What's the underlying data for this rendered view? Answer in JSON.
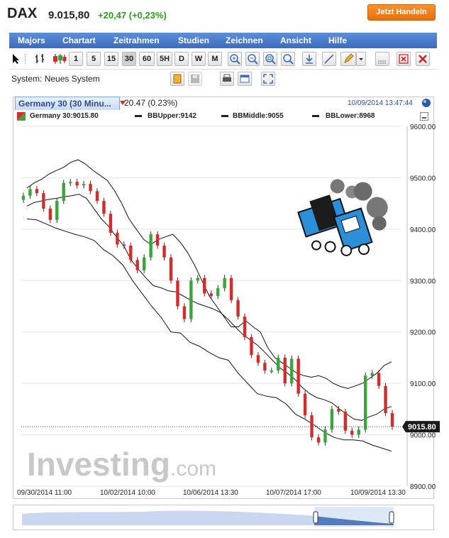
{
  "header": {
    "symbol": "DAX",
    "price": "9.015,80",
    "change": "+20,47 (+0,23%)",
    "trade_button": "Jetzt Handeln"
  },
  "menu": [
    "Majors",
    "Chartart",
    "Zeitrahmen",
    "Studien",
    "Zeichnen",
    "Ansicht",
    "Hilfe"
  ],
  "toolbar": {
    "timeframes": [
      "1",
      "5",
      "15",
      "30",
      "60",
      "5H",
      "D",
      "W",
      "M"
    ],
    "selected_timeframe": "30"
  },
  "system_bar": {
    "label": "System:",
    "value": "Neues System"
  },
  "chart_tab": {
    "title": "Germany 30 (30 Minu...",
    "change": "20.47 (0.23%)",
    "datetime": "10/09/2014 13:47:44"
  },
  "legend": {
    "instrument": "Germany 30:9015.80",
    "bb_upper": "BBUpper:9142",
    "bb_middle": "BBMiddle:9055",
    "bb_lower": "BBLower:8968"
  },
  "watermark": {
    "brand": "Investing",
    "suffix": ".com"
  },
  "colors": {
    "up": "#3aa53a",
    "down": "#d62b2b",
    "accent": "#3a6bbf",
    "trade": "#f0841f"
  },
  "chart_data": {
    "type": "line",
    "title": "Germany 30 (30 Minu...",
    "xlabel": "",
    "ylabel": "",
    "ylim": [
      8900,
      9600
    ],
    "y_ticks": [
      "9600.00",
      "9500.00",
      "9400.00",
      "9300.00",
      "9200.00",
      "9100.00",
      "9000.00",
      "8900.00"
    ],
    "x_ticks": [
      "09/30/2014 11:00",
      "10/02/2014 10:00",
      "10/06/2014 13:30",
      "10/07/2014 17:00",
      "10/09/2014 13:30"
    ],
    "last_price_label": "9015.80",
    "last_price": 9015.8,
    "series": [
      {
        "name": "Germany 30",
        "values": [
          9465,
          9478,
          9470,
          9440,
          9418,
          9455,
          9490,
          9492,
          9485,
          9488,
          9474,
          9455,
          9430,
          9393,
          9370,
          9368,
          9340,
          9320,
          9345,
          9390,
          9368,
          9345,
          9300,
          9250,
          9225,
          9300,
          9305,
          9275,
          9270,
          9285,
          9305,
          9262,
          9230,
          9190,
          9155,
          9140,
          9125,
          9125,
          9150,
          9100,
          9148,
          9080,
          9038,
          8995,
          8985,
          9010,
          9050,
          9045,
          9008,
          9000,
          9010,
          9115,
          9120,
          9095,
          9042,
          9015.8
        ]
      },
      {
        "name": "BBUpper",
        "values": [
          9480,
          9490,
          9497,
          9507,
          9514,
          9520,
          9530,
          9535,
          9527,
          9515,
          9505,
          9495,
          9475,
          9450,
          9420,
          9400,
          9380,
          9370,
          9380,
          9385,
          9390,
          9375,
          9355,
          9330,
          9300,
          9270,
          9250,
          9230,
          9210,
          9210,
          9222,
          9210,
          9200,
          9170,
          9150,
          9140,
          9130,
          9120,
          9115,
          9112,
          9115,
          9110,
          9100,
          9094,
          9090,
          9095,
          9100,
          9110,
          9120,
          9135,
          9142
        ]
      },
      {
        "name": "BBMiddle",
        "values": [
          9445,
          9452,
          9455,
          9458,
          9460,
          9463,
          9465,
          9468,
          9460,
          9440,
          9420,
          9405,
          9385,
          9368,
          9340,
          9322,
          9305,
          9290,
          9286,
          9280,
          9278,
          9270,
          9262,
          9255,
          9250,
          9245,
          9238,
          9225,
          9210,
          9195,
          9185,
          9174,
          9160,
          9145,
          9130,
          9120,
          9108,
          9092,
          9080,
          9072,
          9068,
          9062,
          9050,
          9040,
          9030,
          9028,
          9035,
          9040,
          9050,
          9055
        ]
      },
      {
        "name": "BBLower",
        "values": [
          9420,
          9418,
          9410,
          9402,
          9396,
          9390,
          9385,
          9378,
          9360,
          9348,
          9330,
          9300,
          9275,
          9250,
          9228,
          9200,
          9198,
          9180,
          9172,
          9160,
          9150,
          9145,
          9120,
          9100,
          9080,
          9075,
          9072,
          9060,
          9040,
          9030,
          9018,
          9005,
          8995,
          8990,
          8990,
          8988,
          8980,
          8974,
          8968
        ]
      }
    ]
  }
}
